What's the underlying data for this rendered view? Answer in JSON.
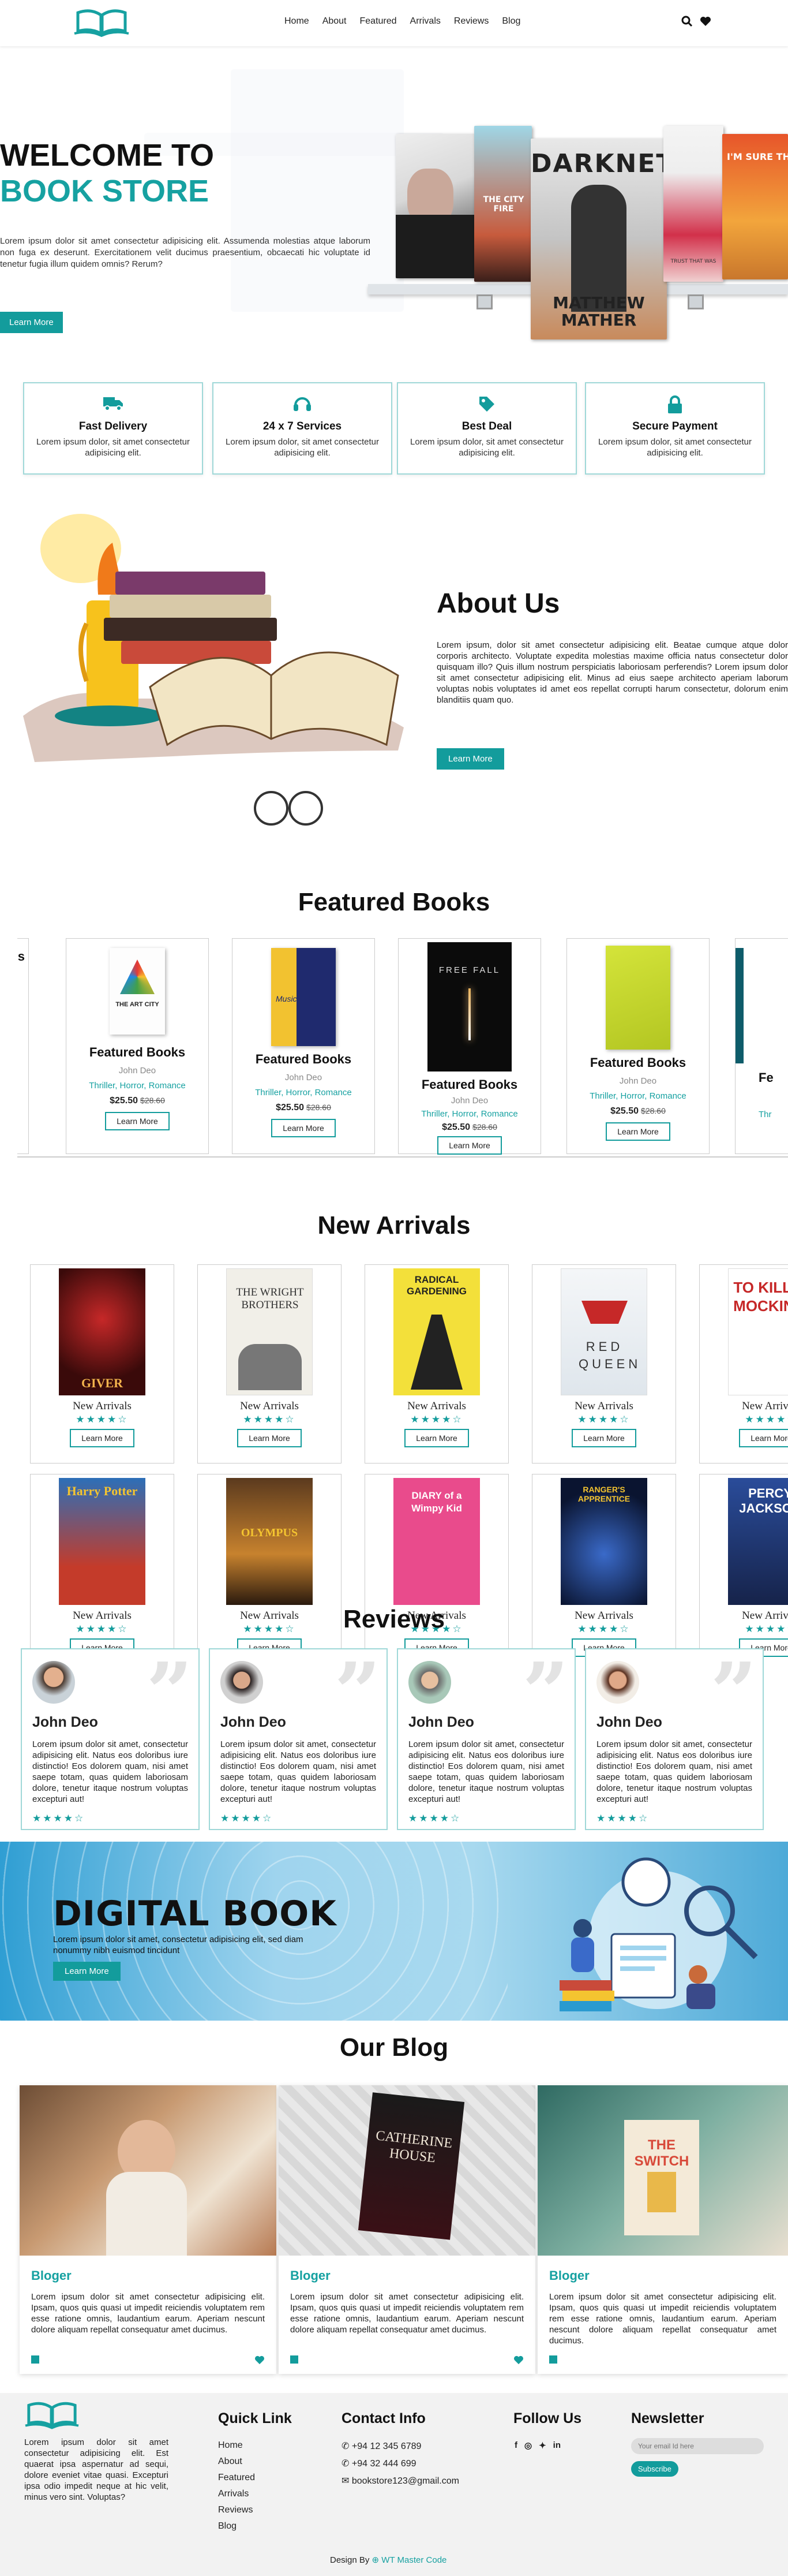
{
  "header": {
    "nav": [
      "Home",
      "About",
      "Featured",
      "Arrivals",
      "Reviews",
      "Blog"
    ],
    "icons": [
      "search-icon",
      "heart-icon"
    ]
  },
  "hero": {
    "title_line1": "WELCOME TO",
    "title_line2": "BOOK STORE",
    "text": "Lorem ipsum dolor sit amet consectetur adipisicing elit. Assumenda molestias atque laborum non fuga ex deserunt. Exercitationem velit ducimus praesentium, obcaecati hic voluptate id tenetur fugia illum quidem omnis? Rerum?",
    "button": "Learn More",
    "books": [
      {
        "title": "",
        "author": ""
      },
      {
        "title": "THE CITY FIRE",
        "author": ""
      },
      {
        "title": "DARKNET",
        "author": "MATTHEW MATHER"
      },
      {
        "title": "",
        "author": "TRUST THAT WAS"
      },
      {
        "title": "I'M SURE TH...",
        "author": ""
      }
    ]
  },
  "features": [
    {
      "title": "Fast Delivery",
      "text": "Lorem ipsum dolor, sit amet consectetur adipisicing elit.",
      "icon": "truck-icon"
    },
    {
      "title": "24 x 7 Services",
      "text": "Lorem ipsum dolor, sit amet consectetur adipisicing elit.",
      "icon": "headset-icon"
    },
    {
      "title": "Best Deal",
      "text": "Lorem ipsum dolor, sit amet consectetur adipisicing elit.",
      "icon": "tag-icon"
    },
    {
      "title": "Secure Payment",
      "text": "Lorem ipsum dolor, sit amet consectetur adipisicing elit.",
      "icon": "lock-icon"
    }
  ],
  "about": {
    "title": "About Us",
    "text": "Lorem ipsum, dolor sit amet consectetur adipisicing elit. Beatae cumque atque dolor corporis architecto. Voluptate expedita molestias maxime officia natus consectetur dolor quisquam illo? Quis illum nostrum perspiciatis laboriosam perferendis? Lorem ipsum dolor sit amet consectetur adipisicing elit. Minus ad eius saepe architecto aperiam laborum voluptas nobis voluptates id amet eos repellat corrupti harum consectetur, dolorum enim blanditiis quam quo.",
    "button": "Learn More"
  },
  "featured": {
    "title": "Featured Books",
    "cards": [
      {
        "name": "Featured Books",
        "author": "John Deo",
        "genre": "Thriller, Horror, Romance",
        "price": "$25.50",
        "old": "$28.60",
        "button": "Learn More",
        "cover": "THE ART CITY"
      },
      {
        "name": "Featured Books",
        "author": "John Deo",
        "genre": "Thriller, Horror, Romance",
        "price": "$25.50",
        "old": "$28.60",
        "button": "Learn More",
        "cover": "Music"
      },
      {
        "name": "Featured Books",
        "author": "John Deo",
        "genre": "Thriller, Horror, Romance",
        "price": "$25.50",
        "old": "$28.60",
        "button": "Learn More",
        "cover": "FREE FALL"
      },
      {
        "name": "Featured Books",
        "author": "John Deo",
        "genre": "Thriller, Horror, Romance",
        "price": "$25.50",
        "old": "$28.60",
        "button": "Learn More",
        "cover": ""
      }
    ],
    "partial_right": {
      "name": "Fe",
      "genre": "Thr"
    },
    "partial_left": {
      "name": "s"
    }
  },
  "arrivals": {
    "title": "New Arrivals",
    "caption": "New Arrivals",
    "button": "Learn More",
    "row1": [
      "GIVER",
      "THE WRIGHT BROTHERS",
      "RADICAL GARDENING",
      "RED QUEEN",
      "TO KILL A MOCKING"
    ],
    "row2": [
      "Harry Potter",
      "OLYMPUS",
      "DIARY of a Wimpy Kid",
      "RANGER'S APPRENTICE",
      "PERCY JACKSON"
    ]
  },
  "reviews": {
    "title": "Reviews",
    "cards": [
      {
        "name": "John Deo",
        "text": "Lorem ipsum dolor sit amet, consectetur adipisicing elit. Natus eos doloribus iure distinctio! Eos dolorem quam, nisi amet saepe totam, quas quidem laboriosam dolore, tenetur itaque nostrum voluptas excepturi aut!"
      },
      {
        "name": "John Deo",
        "text": "Lorem ipsum dolor sit amet, consectetur adipisicing elit. Natus eos doloribus iure distinctio! Eos dolorem quam, nisi amet saepe totam, quas quidem laboriosam dolore, tenetur itaque nostrum voluptas excepturi aut!"
      },
      {
        "name": "John Deo",
        "text": "Lorem ipsum dolor sit amet, consectetur adipisicing elit. Natus eos doloribus iure distinctio! Eos dolorem quam, nisi amet saepe totam, quas quidem laboriosam dolore, tenetur itaque nostrum voluptas excepturi aut!"
      },
      {
        "name": "John Deo",
        "text": "Lorem ipsum dolor sit amet, consectetur adipisicing elit. Natus eos doloribus iure distinctio! Eos dolorem quam, nisi amet saepe totam, quas quidem laboriosam dolore, tenetur itaque nostrum voluptas excepturi aut!"
      }
    ]
  },
  "digital": {
    "title": "DIGITAL BOOK",
    "text": "Lorem ipsum dolor sit amet, consectetur adipisicing elit, sed diam nonummy nibh euismod tincidunt",
    "button": "Learn More"
  },
  "blog": {
    "title": "Our Blog",
    "cards": [
      {
        "name": "Bloger",
        "text": "Lorem ipsum dolor sit amet consectetur adipisicing elit. Ipsam, quos quis quasi ut impedit reiciendis voluptatem rem esse ratione omnis, laudantium earum. Aperiam nescunt dolore aliquam repellat consequatur amet ducimus."
      },
      {
        "name": "Bloger",
        "text": "Lorem ipsum dolor sit amet consectetur adipisicing elit. Ipsam, quos quis quasi ut impedit reiciendis voluptatem rem esse ratione omnis, laudantium earum. Aperiam nescunt dolore aliquam repellat consequatur amet ducimus."
      },
      {
        "name": "Bloger",
        "text": "Lorem ipsum dolor sit amet consectetur adipisicing elit. Ipsam, quos quis quasi ut impedit reiciendis voluptatem rem esse ratione omnis, laudantium earum. Aperiam nescunt dolore aliquam repellat consequatur amet ducimus."
      }
    ],
    "covers": [
      "",
      "CATHERINE HOUSE",
      "THE SWITCH"
    ]
  },
  "footer": {
    "about": "Lorem ipsum dolor sit amet consectetur adipisicing elit. Est quaerat ipsa aspernatur ad sequi, dolore eveniet vitae quasi. Excepturi ipsa odio impedit neque at hic velit, minus vero sint. Voluptas?",
    "quick_title": "Quick Link",
    "links": [
      "Home",
      "About",
      "Featured",
      "Arrivals",
      "Reviews",
      "Blog"
    ],
    "contact_title": "Contact Info",
    "phone1": "+94 12 345 6789",
    "phone2": "+94 32 444 699",
    "email": "bookstore123@gmail.com",
    "follow_title": "Follow Us",
    "news_title": "Newsletter",
    "news_placeholder": "Your email Id here",
    "subscribe": "Subscribe",
    "credit_prefix": "Design By",
    "credit_name": "WT Master Code"
  },
  "colors": {
    "accent": "#139c9c",
    "heading": "#111111"
  }
}
